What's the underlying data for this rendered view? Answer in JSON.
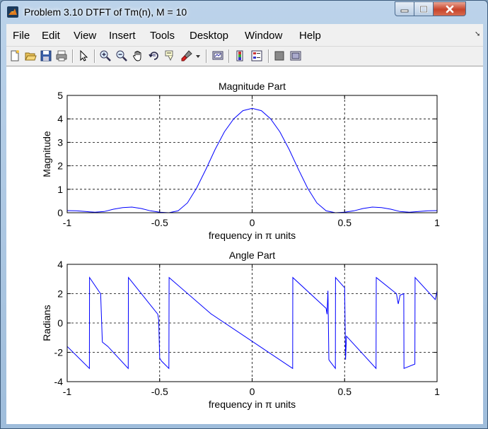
{
  "window": {
    "title": "Problem 3.10 DTFT of Tm(n), M = 10"
  },
  "menu": {
    "items": [
      "File",
      "Edit",
      "View",
      "Insert",
      "Tools",
      "Desktop",
      "Window",
      "Help"
    ]
  },
  "toolbar": {
    "icons": [
      "new-figure-icon",
      "open-file-icon",
      "save-icon",
      "print-icon",
      "edit-plot-arrow-icon",
      "zoom-in-icon",
      "zoom-out-icon",
      "pan-hand-icon",
      "rotate-3d-icon",
      "data-cursor-icon",
      "brush-icon",
      "link-plot-icon",
      "colorbar-icon",
      "legend-icon",
      "hide-plot-tools-icon",
      "show-plot-tools-icon"
    ]
  },
  "colors": {
    "line": "#0000ff",
    "axes": "#000000",
    "background": "#ffffff"
  },
  "chart_data": [
    {
      "type": "line",
      "title": "Magnitude Part",
      "xlabel": "frequency in π units",
      "ylabel": "Magnitude",
      "xlim": [
        -1,
        1
      ],
      "ylim": [
        0,
        5
      ],
      "xticks": [
        -1,
        -0.5,
        0,
        0.5,
        1
      ],
      "xtick_labels": [
        "-1",
        "-0.5",
        "0",
        "0.5",
        "1"
      ],
      "yticks": [
        0,
        1,
        2,
        3,
        4,
        5
      ],
      "ytick_labels": [
        "0",
        "1",
        "2",
        "3",
        "4",
        "5"
      ],
      "grid": true,
      "x": [
        -1.0,
        -0.95,
        -0.9,
        -0.85,
        -0.8,
        -0.75,
        -0.7,
        -0.65,
        -0.6,
        -0.55,
        -0.5,
        -0.45,
        -0.4,
        -0.35,
        -0.3,
        -0.25,
        -0.2,
        -0.15,
        -0.1,
        -0.05,
        0.0,
        0.05,
        0.1,
        0.15,
        0.2,
        0.25,
        0.3,
        0.35,
        0.4,
        0.45,
        0.5,
        0.55,
        0.6,
        0.65,
        0.7,
        0.75,
        0.8,
        0.85,
        0.9,
        0.95,
        1.0
      ],
      "y": [
        0.09,
        0.08,
        0.05,
        0.02,
        0.05,
        0.15,
        0.22,
        0.24,
        0.18,
        0.08,
        0.02,
        0.0,
        0.08,
        0.42,
        1.05,
        1.85,
        2.7,
        3.45,
        4.0,
        4.35,
        4.45,
        4.35,
        4.0,
        3.45,
        2.7,
        1.85,
        1.05,
        0.42,
        0.08,
        0.0,
        0.02,
        0.08,
        0.18,
        0.24,
        0.22,
        0.15,
        0.05,
        0.02,
        0.05,
        0.08,
        0.09
      ]
    },
    {
      "type": "line",
      "title": "Angle Part",
      "xlabel": "frequency in π units",
      "ylabel": "Radians",
      "xlim": [
        -1,
        1
      ],
      "ylim": [
        -4,
        4
      ],
      "xticks": [
        -1,
        -0.5,
        0,
        0.5,
        1
      ],
      "xtick_labels": [
        "-1",
        "-0.5",
        "0",
        "0.5",
        "1"
      ],
      "yticks": [
        -4,
        -2,
        0,
        2,
        4
      ],
      "ytick_labels": [
        "-4",
        "-2",
        "0",
        "2",
        "4"
      ],
      "grid": true,
      "x": [
        -1.0,
        -0.88,
        -0.879,
        -0.82,
        -0.819,
        -0.81,
        -0.78,
        -0.67,
        -0.669,
        -0.51,
        -0.505,
        -0.5,
        -0.495,
        -0.49,
        -0.45,
        -0.449,
        -0.22,
        -0.219,
        0.219,
        0.22,
        0.4,
        0.405,
        0.41,
        0.415,
        0.42,
        0.45,
        0.451,
        0.5,
        0.505,
        0.51,
        0.67,
        0.671,
        0.78,
        0.79,
        0.8,
        0.82,
        0.821,
        0.88,
        0.881,
        0.99,
        1.0
      ],
      "y": [
        -1.6,
        -3.1,
        3.1,
        2.0,
        2.0,
        -1.3,
        -1.6,
        -3.1,
        3.1,
        0.6,
        0.2,
        -2.4,
        -2.5,
        -2.6,
        -3.1,
        3.1,
        0.6,
        0.6,
        -3.1,
        3.1,
        1.0,
        0.6,
        2.2,
        -2.5,
        -2.6,
        -3.1,
        3.1,
        2.4,
        -2.5,
        -0.9,
        -3.1,
        3.1,
        2.0,
        1.3,
        1.9,
        2.0,
        -3.1,
        -2.8,
        3.1,
        1.6,
        2.2
      ]
    }
  ]
}
